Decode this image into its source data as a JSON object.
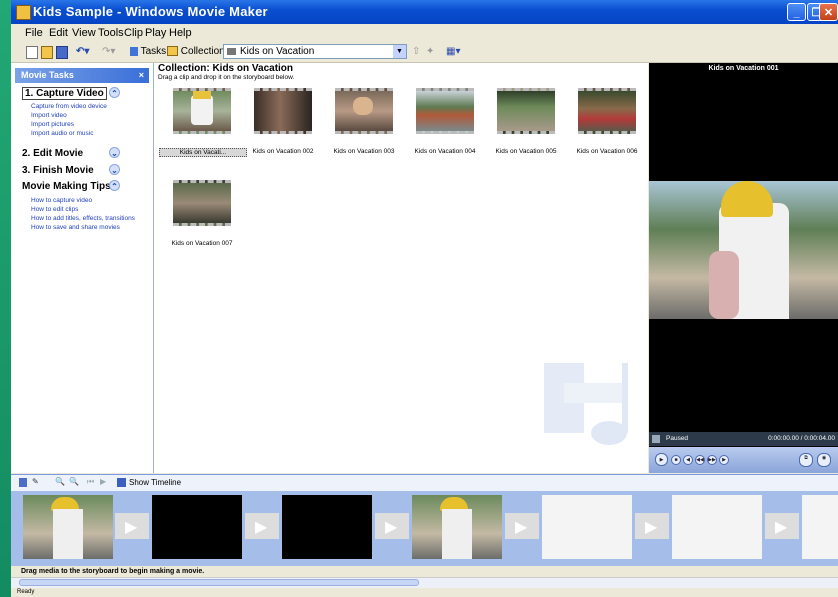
{
  "window": {
    "title": "Kids Sample - Windows Movie Maker"
  },
  "menu": [
    "File",
    "Edit",
    "View",
    "Tools",
    "Clip",
    "Play",
    "Help"
  ],
  "toolbar": {
    "tasks_label": "Tasks",
    "collections_label": "Collections",
    "collection_value": "Kids on Vacation"
  },
  "tasks_pane": {
    "header": "Movie Tasks",
    "capture": {
      "title": "1. Capture Video",
      "links": [
        "Capture from video device",
        "Import video",
        "Import pictures",
        "Import audio or music"
      ]
    },
    "edit": {
      "title": "2. Edit Movie"
    },
    "finish": {
      "title": "3. Finish Movie"
    },
    "tips": {
      "title": "Movie Making Tips",
      "links": [
        "How to capture video",
        "How to edit clips",
        "How to add titles, effects, transitions",
        "How to save and share movies"
      ]
    }
  },
  "collection": {
    "title": "Collection: Kids on Vacation",
    "subtitle": "Drag a clip and drop it on the storyboard below.",
    "clips": [
      "Kids on Vacati...",
      "Kids on Vacation 002",
      "Kids on Vacation 003",
      "Kids on Vacation 004",
      "Kids on Vacation 005",
      "Kids on Vacation 006",
      "Kids on Vacation 007"
    ]
  },
  "preview": {
    "title": "Kids on Vacation 001",
    "status": "Paused",
    "time": "0:00:00.00 / 0:00:04.00"
  },
  "storyboard": {
    "show_timeline_label": "Show Timeline",
    "hint": "Drag media to the storyboard to begin making a movie."
  },
  "statusbar": {
    "text": "Ready"
  },
  "colors": {
    "titlebar": "#0a4fd1",
    "storyboard": "#a5bde9",
    "link": "#1f3fbf"
  }
}
